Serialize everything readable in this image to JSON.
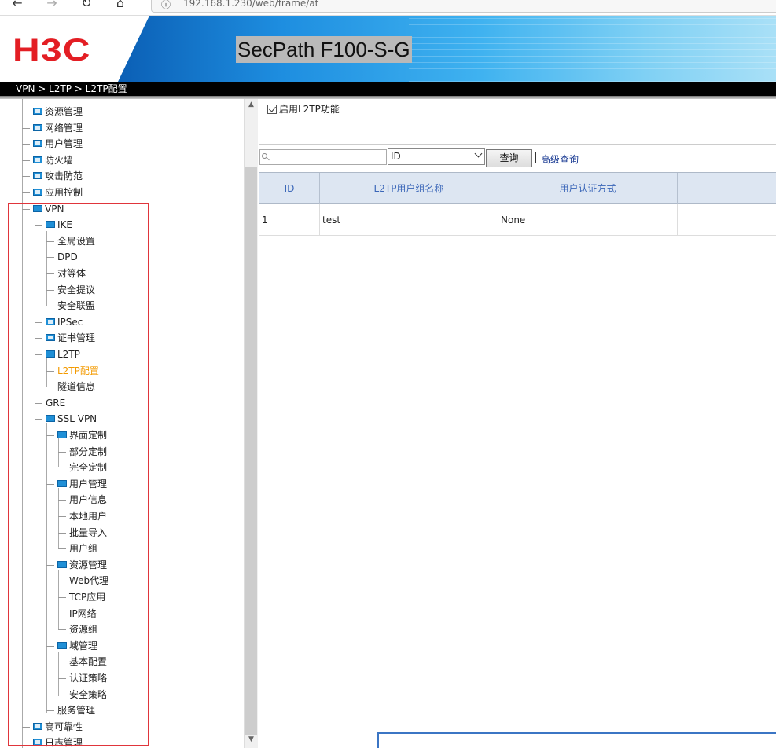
{
  "browser": {
    "back_icon": "arrow-left-icon",
    "forward_icon": "arrow-right-icon",
    "reload_icon": "reload-icon",
    "home_icon": "home-icon",
    "url": "192.168.1.230/web/frame/at"
  },
  "header": {
    "logo": "H3C",
    "product": "SecPath F100-S-G",
    "logo_color": "#e31e24"
  },
  "breadcrumb": "VPN > L2TP > L2TP配置",
  "sidebar": {
    "items": [
      {
        "label": "资源管理",
        "level": 1,
        "type": "folder-closed"
      },
      {
        "label": "网络管理",
        "level": 1,
        "type": "folder-closed"
      },
      {
        "label": "用户管理",
        "level": 1,
        "type": "folder-closed"
      },
      {
        "label": "防火墙",
        "level": 1,
        "type": "folder-closed"
      },
      {
        "label": "攻击防范",
        "level": 1,
        "type": "folder-closed"
      },
      {
        "label": "应用控制",
        "level": 1,
        "type": "folder-closed"
      },
      {
        "label": "VPN",
        "level": 1,
        "type": "folder-open"
      },
      {
        "label": "IKE",
        "level": 2,
        "type": "folder-open"
      },
      {
        "label": "全局设置",
        "level": 3,
        "type": "leaf"
      },
      {
        "label": "DPD",
        "level": 3,
        "type": "leaf"
      },
      {
        "label": "对等体",
        "level": 3,
        "type": "leaf"
      },
      {
        "label": "安全提议",
        "level": 3,
        "type": "leaf"
      },
      {
        "label": "安全联盟",
        "level": 3,
        "type": "leaf"
      },
      {
        "label": "IPSec",
        "level": 2,
        "type": "folder-closed"
      },
      {
        "label": "证书管理",
        "level": 2,
        "type": "folder-closed"
      },
      {
        "label": "L2TP",
        "level": 2,
        "type": "folder-open"
      },
      {
        "label": "L2TP配置",
        "level": 3,
        "type": "leaf",
        "active": true
      },
      {
        "label": "隧道信息",
        "level": 3,
        "type": "leaf"
      },
      {
        "label": "GRE",
        "level": 2,
        "type": "leaf"
      },
      {
        "label": "SSL VPN",
        "level": 2,
        "type": "folder-open"
      },
      {
        "label": "界面定制",
        "level": 3,
        "type": "folder-open"
      },
      {
        "label": "部分定制",
        "level": 4,
        "type": "leaf"
      },
      {
        "label": "完全定制",
        "level": 4,
        "type": "leaf"
      },
      {
        "label": "用户管理",
        "level": 3,
        "type": "folder-open"
      },
      {
        "label": "用户信息",
        "level": 4,
        "type": "leaf"
      },
      {
        "label": "本地用户",
        "level": 4,
        "type": "leaf"
      },
      {
        "label": "批量导入",
        "level": 4,
        "type": "leaf"
      },
      {
        "label": "用户组",
        "level": 4,
        "type": "leaf"
      },
      {
        "label": "资源管理",
        "level": 3,
        "type": "folder-open"
      },
      {
        "label": "Web代理",
        "level": 4,
        "type": "leaf"
      },
      {
        "label": "TCP应用",
        "level": 4,
        "type": "leaf"
      },
      {
        "label": "IP网络",
        "level": 4,
        "type": "leaf"
      },
      {
        "label": "资源组",
        "level": 4,
        "type": "leaf"
      },
      {
        "label": "域管理",
        "level": 3,
        "type": "folder-open"
      },
      {
        "label": "基本配置",
        "level": 4,
        "type": "leaf"
      },
      {
        "label": "认证策略",
        "level": 4,
        "type": "leaf"
      },
      {
        "label": "安全策略",
        "level": 4,
        "type": "leaf"
      },
      {
        "label": "服务管理",
        "level": 3,
        "type": "leaf"
      },
      {
        "label": "高可靠性",
        "level": 1,
        "type": "folder-closed"
      },
      {
        "label": "日志管理",
        "level": 1,
        "type": "folder-closed"
      }
    ],
    "active_color": "#f39a00",
    "highlight_color": "#e0353b"
  },
  "main": {
    "enable_label": "启用L2TP功能",
    "enable_checked": true,
    "search_placeholder": "",
    "search_icon": "search-icon",
    "select_value": "ID",
    "query_label": "查询",
    "advanced_label": "高级查询",
    "table": {
      "headers": [
        "ID",
        "L2TP用户组名称",
        "用户认证方式",
        ""
      ],
      "rows": [
        [
          "1",
          "test",
          "None",
          ""
        ]
      ]
    }
  }
}
